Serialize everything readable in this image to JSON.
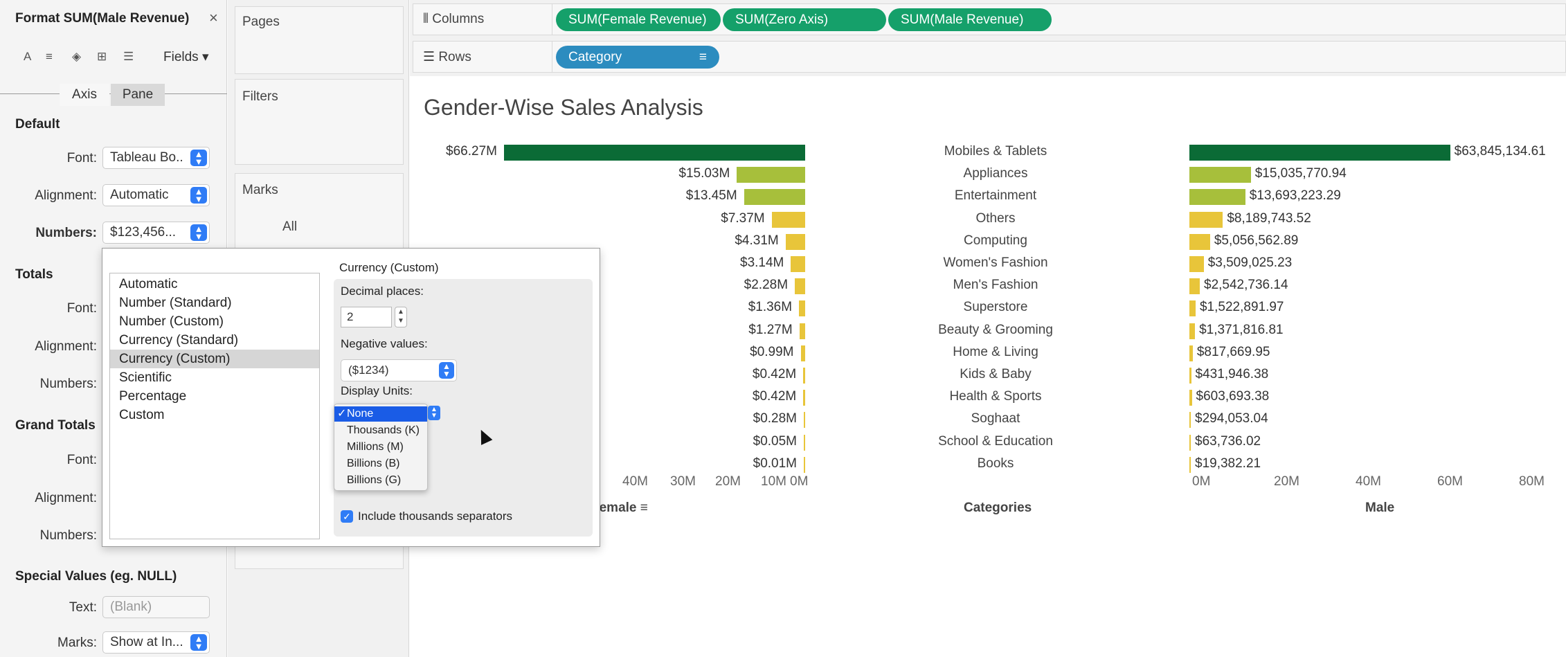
{
  "format_pane": {
    "title": "Format SUM(Male Revenue)",
    "close_icon": "×",
    "tools": [
      "A",
      "≡",
      "◈",
      "⊞",
      "☰"
    ],
    "fields_label": "Fields ▾",
    "tabs": {
      "axis": "Axis",
      "pane": "Pane"
    },
    "default": {
      "title": "Default",
      "font_label": "Font:",
      "font_value": "Tableau Bo..",
      "alignment_label": "Alignment:",
      "alignment_value": "Automatic",
      "numbers_label": "Numbers:",
      "numbers_value": "$123,456..."
    },
    "totals": {
      "title": "Totals",
      "font_label": "Font:",
      "alignment_label": "Alignment:",
      "numbers_label": "Numbers:"
    },
    "grand_totals": {
      "title": "Grand Totals",
      "font_label": "Font:",
      "alignment_label": "Alignment:",
      "numbers_label": "Numbers:"
    },
    "special": {
      "title": "Special Values (eg. NULL)",
      "text_label": "Text:",
      "text_placeholder": "(Blank)",
      "marks_label": "Marks:",
      "marks_value": "Show at In..."
    }
  },
  "cards": {
    "pages": "Pages",
    "filters": "Filters",
    "marks": "Marks",
    "marks_all": "All"
  },
  "shelves": {
    "columns_label": "Columns",
    "rows_label": "Rows",
    "columns_pills": [
      "SUM(Female Revenue)",
      "SUM(Zero Axis)",
      "SUM(Male Revenue)"
    ],
    "rows_pills": [
      "Category"
    ]
  },
  "number_format_popup": {
    "formats": [
      "Automatic",
      "Number (Standard)",
      "Number (Custom)",
      "Currency (Standard)",
      "Currency (Custom)",
      "Scientific",
      "Percentage",
      "Custom"
    ],
    "selected_format": "Currency (Custom)",
    "panel_title": "Currency (Custom)",
    "decimal_label": "Decimal places:",
    "decimal_value": "2",
    "negative_label": "Negative values:",
    "negative_value": "($1234)",
    "units_label": "Display Units:",
    "units_options": [
      "None",
      "Thousands (K)",
      "Millions (M)",
      "Billions (B)",
      "Billions (G)"
    ],
    "units_selected": "None",
    "separator_label": "Include thousands separators",
    "separator_checked": true
  },
  "chart_data": {
    "type": "bar",
    "title": "Gender-Wise Sales Analysis",
    "categories": [
      "Mobiles & Tablets",
      "Appliances",
      "Entertainment",
      "Others",
      "Computing",
      "Women's Fashion",
      "Men's Fashion",
      "Superstore",
      "Beauty & Grooming",
      "Home & Living",
      "Kids & Baby",
      "Health & Sports",
      "Soghaat",
      "School & Education",
      "Books"
    ],
    "series": [
      {
        "name": "Female",
        "values": [
          66270000,
          15030000,
          13450000,
          7370000,
          4310000,
          3140000,
          2280000,
          1360000,
          1270000,
          990000,
          420000,
          420000,
          280000,
          50000,
          10000
        ],
        "labels": [
          "$66.27M",
          "$15.03M",
          "$13.45M",
          "$7.37M",
          "$4.31M",
          "$3.14M",
          "$2.28M",
          "$1.36M",
          "$1.27M",
          "$0.99M",
          "$0.42M",
          "$0.42M",
          "$0.28M",
          "$0.05M",
          "$0.01M"
        ]
      },
      {
        "name": "Male",
        "values": [
          63845134.61,
          15035770.94,
          13693223.29,
          8189743.52,
          5056562.89,
          3509025.23,
          2542736.14,
          1522891.97,
          1371816.81,
          817669.95,
          431946.38,
          603693.38,
          294053.04,
          63736.02,
          19382.21
        ],
        "labels": [
          "$63,845,134.61",
          "$15,035,770.94",
          "$13,693,223.29",
          "$8,189,743.52",
          "$5,056,562.89",
          "$3,509,025.23",
          "$2,542,736.14",
          "$1,522,891.97",
          "$1,371,816.81",
          "$817,669.95",
          "$431,946.38",
          "$603,693.38",
          "$294,053.04",
          "$63,736.02",
          "$19,382.21"
        ]
      }
    ],
    "female_axis": {
      "ticks": [
        "40M",
        "30M",
        "20M",
        "10M",
        "0M"
      ],
      "reversed": true,
      "title": "Female"
    },
    "male_axis": {
      "ticks": [
        "0M",
        "20M",
        "40M",
        "60M",
        "80M"
      ],
      "range": [
        0,
        80000000
      ],
      "title": "Male"
    },
    "category_header": "Categories",
    "colors": {
      "high": "#0b6b36",
      "mid": "#a7bf3b",
      "low": "#e8c53a"
    }
  }
}
